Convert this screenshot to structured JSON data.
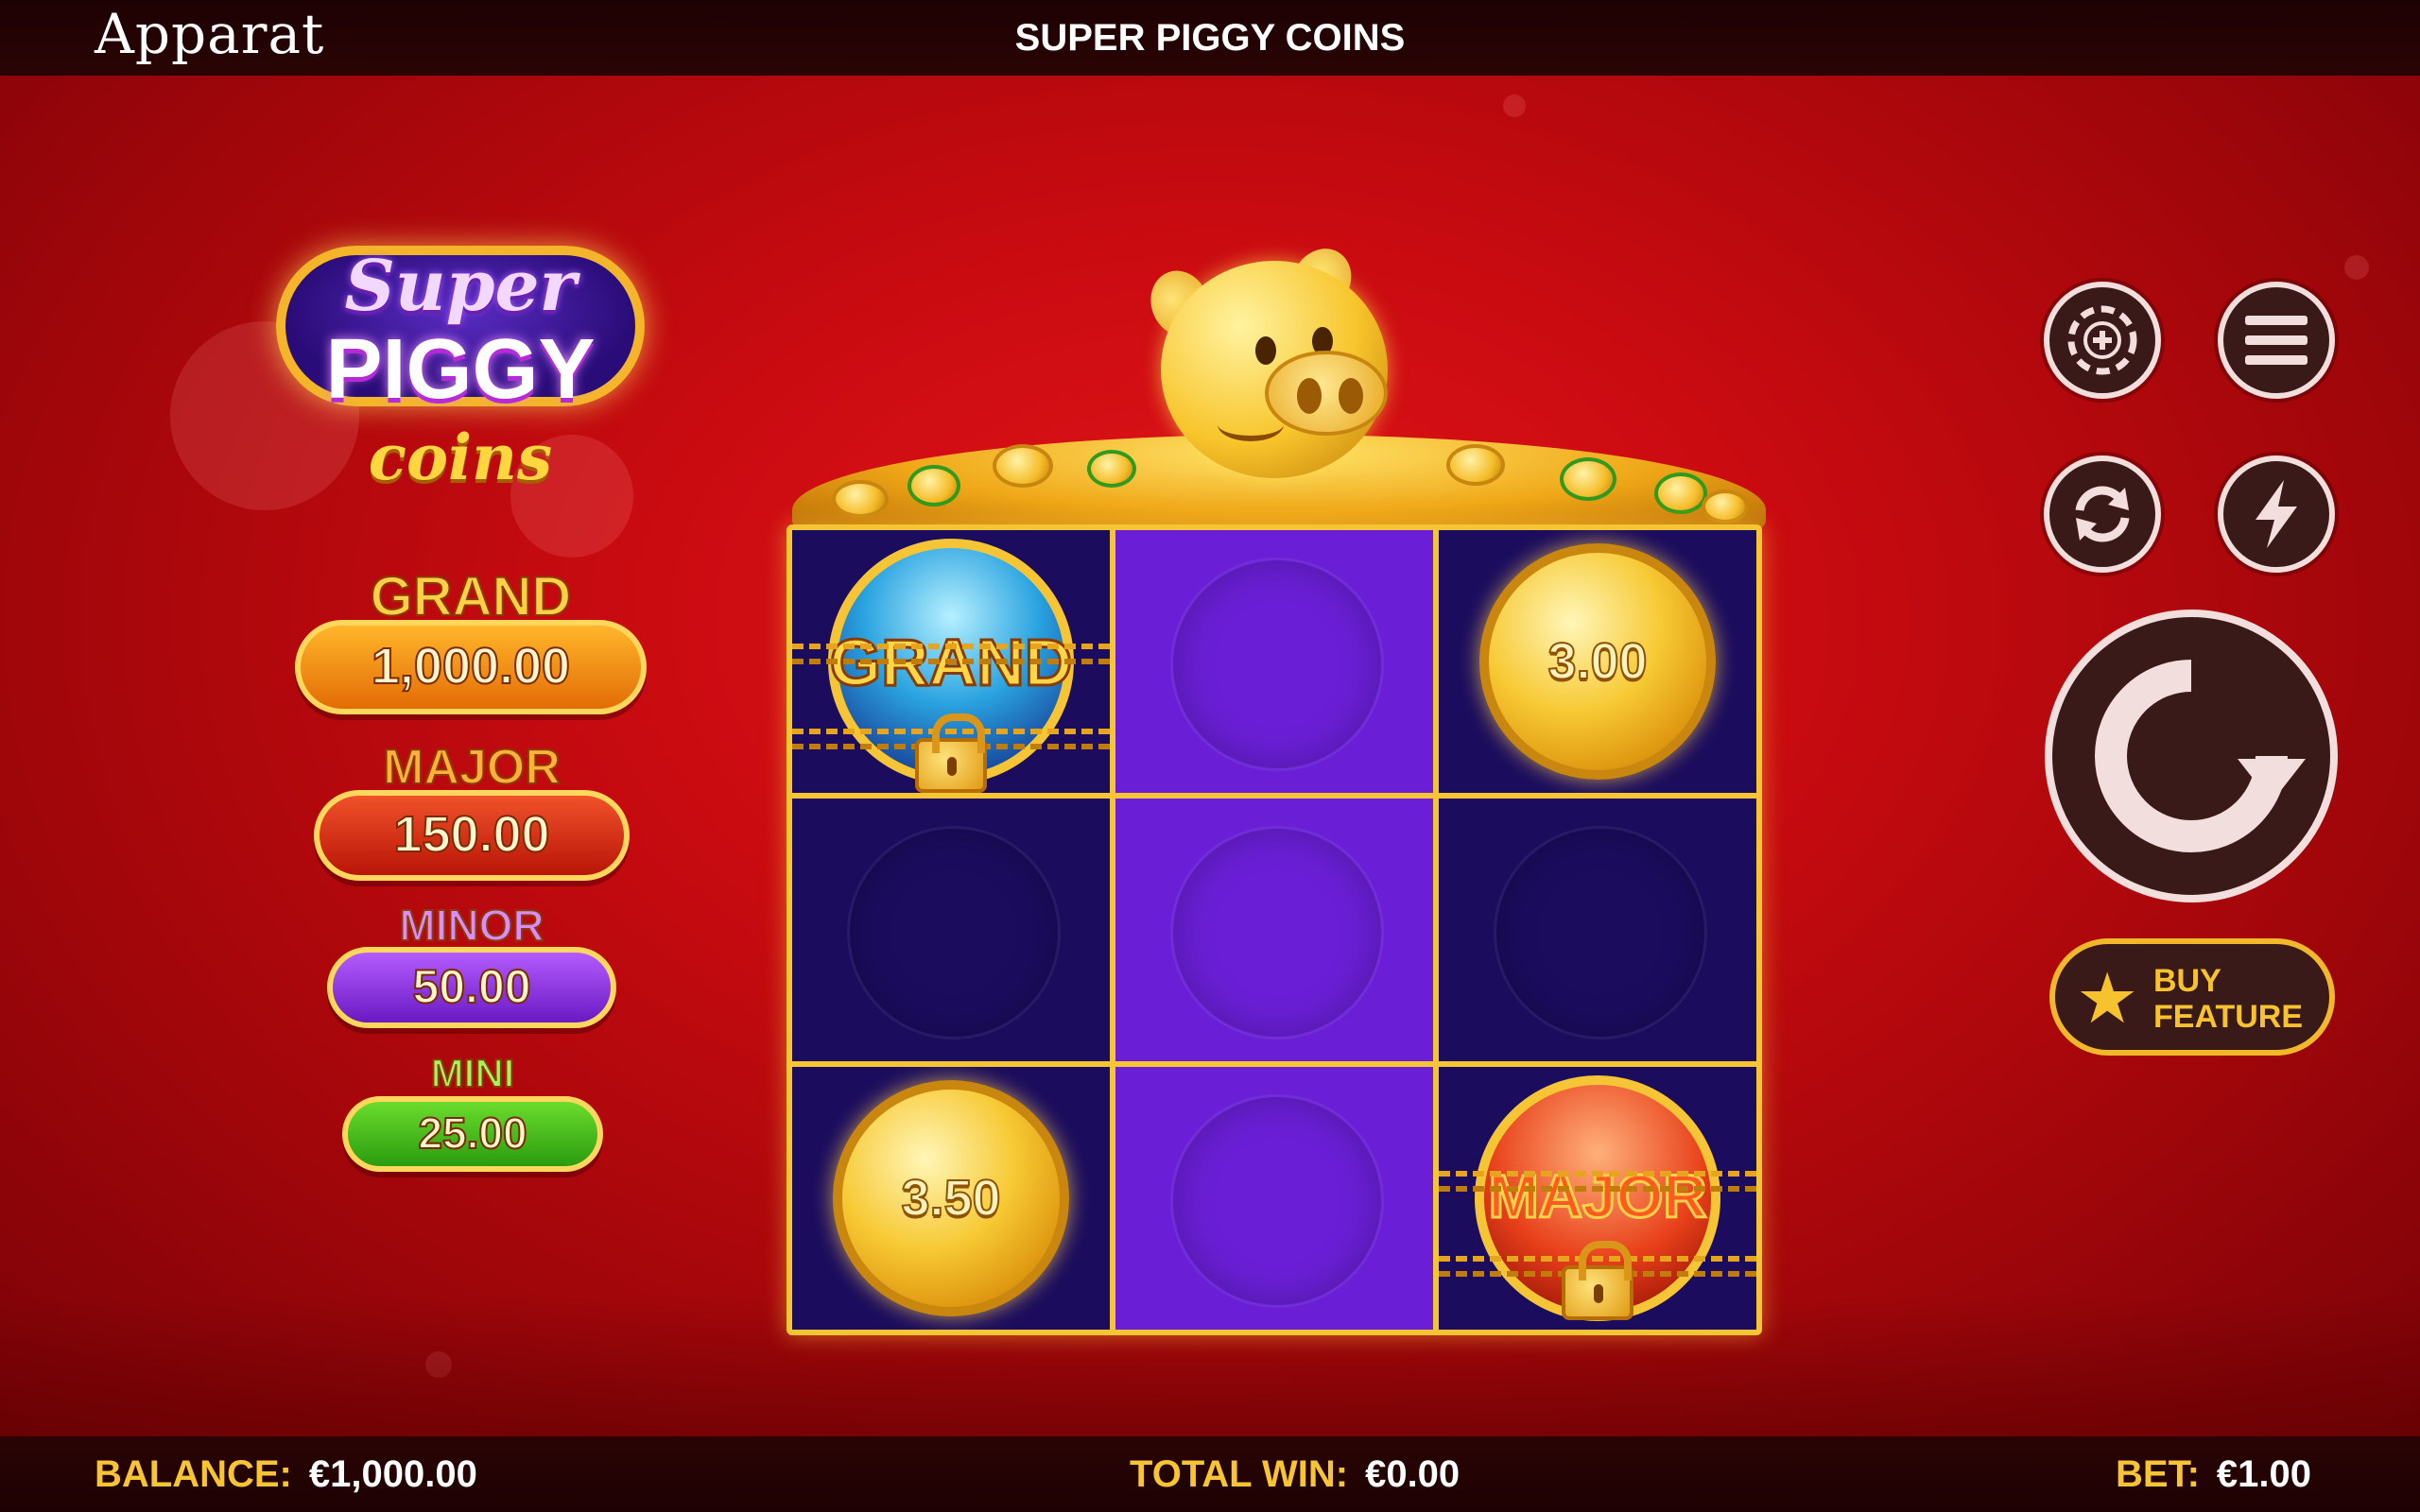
{
  "header": {
    "brand": "Apparat",
    "title": "SUPER PIGGY COINS"
  },
  "logo": {
    "line1": "Super",
    "line2": "PIGGY",
    "line3": "coins"
  },
  "jackpots": [
    {
      "name": "GRAND",
      "value": "1,000.00",
      "color": "#f08a0a"
    },
    {
      "name": "MAJOR",
      "value": "150.00",
      "color": "#d92a16"
    },
    {
      "name": "MINOR",
      "value": "50.00",
      "color": "#8a2ad8"
    },
    {
      "name": "MINI",
      "value": "25.00",
      "color": "#3fb21a"
    }
  ],
  "grid": {
    "cells": [
      {
        "type": "jackpot",
        "label": "GRAND",
        "locked": true
      },
      {
        "type": "empty"
      },
      {
        "type": "coin",
        "value": "3.00"
      },
      {
        "type": "empty"
      },
      {
        "type": "empty"
      },
      {
        "type": "empty"
      },
      {
        "type": "coin",
        "value": "3.50"
      },
      {
        "type": "empty"
      },
      {
        "type": "jackpot",
        "label": "MAJOR",
        "locked": true
      }
    ]
  },
  "controls": {
    "bet_chip_icon": "poker-chip-icon",
    "menu_icon": "hamburger-menu-icon",
    "autoplay_icon": "autoplay-icon",
    "turbo_icon": "lightning-icon",
    "spin_icon": "spin-arrow-icon",
    "buy_feature_label_1": "BUY",
    "buy_feature_label_2": "FEATURE"
  },
  "footer": {
    "balance_label": "BALANCE:",
    "balance_value": "€1,000.00",
    "total_win_label": "TOTAL WIN:",
    "total_win_value": "€0.00",
    "bet_label": "BET:",
    "bet_value": "€1.00"
  },
  "colors": {
    "accent": "#f6c535",
    "background": "#c80b10",
    "cell_dark": "#1b0c5e",
    "cell_purple": "#6a1fd6"
  }
}
